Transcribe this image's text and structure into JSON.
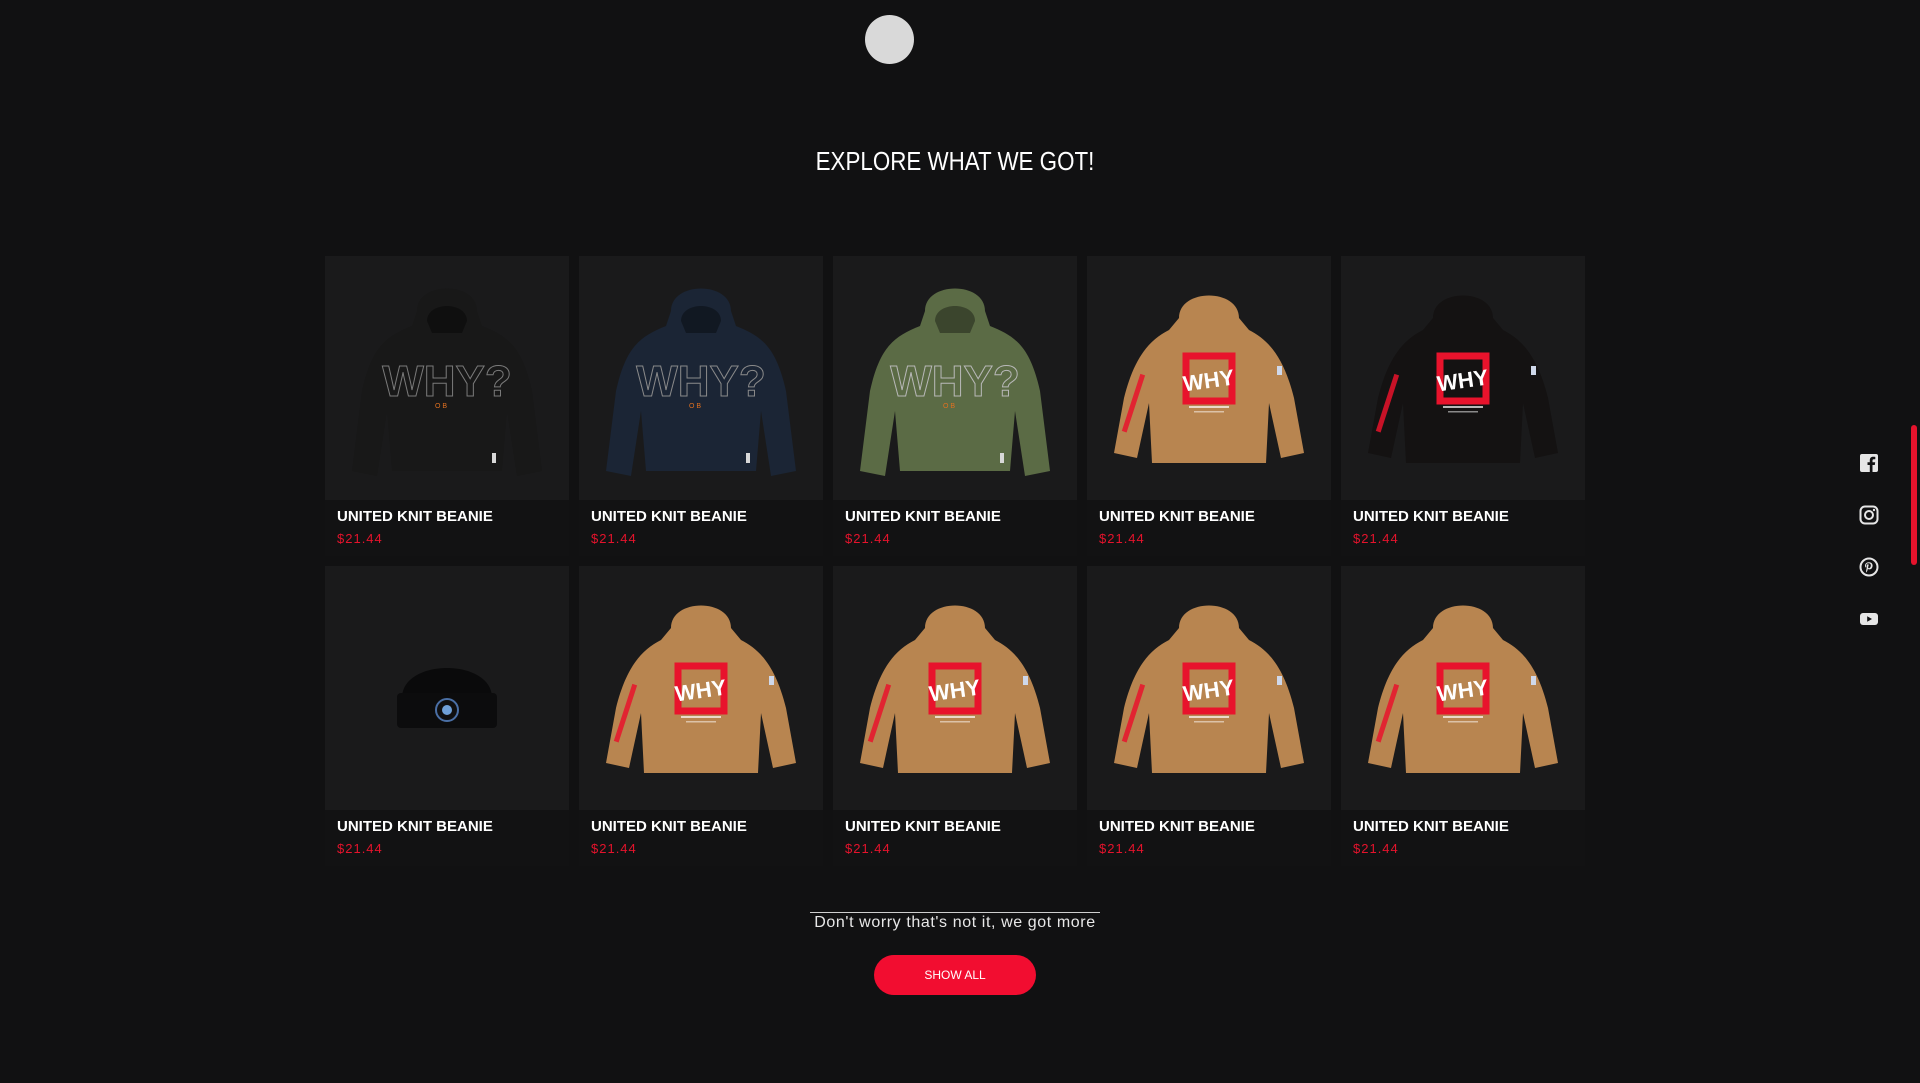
{
  "section": {
    "title": "EXPLORE WHAT WE GOT!"
  },
  "products": [
    {
      "name": "UNITED KNIT BEANIE",
      "price": "$21.44",
      "image": "hoodie-black-why-front"
    },
    {
      "name": "UNITED KNIT BEANIE",
      "price": "$21.44",
      "image": "hoodie-navy-why-front"
    },
    {
      "name": "UNITED KNIT BEANIE",
      "price": "$21.44",
      "image": "hoodie-olive-why-front"
    },
    {
      "name": "UNITED KNIT BEANIE",
      "price": "$21.44",
      "image": "hoodie-tan-why-back"
    },
    {
      "name": "UNITED KNIT BEANIE",
      "price": "$21.44",
      "image": "hoodie-black-why-back"
    },
    {
      "name": "UNITED KNIT BEANIE",
      "price": "$21.44",
      "image": "beanie-black"
    },
    {
      "name": "UNITED KNIT BEANIE",
      "price": "$21.44",
      "image": "hoodie-tan-why-back"
    },
    {
      "name": "UNITED KNIT BEANIE",
      "price": "$21.44",
      "image": "hoodie-tan-why-back"
    },
    {
      "name": "UNITED KNIT BEANIE",
      "price": "$21.44",
      "image": "hoodie-tan-why-back"
    },
    {
      "name": "UNITED KNIT BEANIE",
      "price": "$21.44",
      "image": "hoodie-tan-why-back"
    }
  ],
  "more": {
    "text": "Don't worry that's not it, we got more",
    "button_label": "SHOW ALL"
  },
  "social": [
    "facebook-icon",
    "instagram-icon",
    "pinterest-icon",
    "youtube-icon"
  ],
  "colors": {
    "background": "#111112",
    "accent": "#f20d30",
    "price": "#e5132c",
    "card": "#1a1a1b"
  }
}
